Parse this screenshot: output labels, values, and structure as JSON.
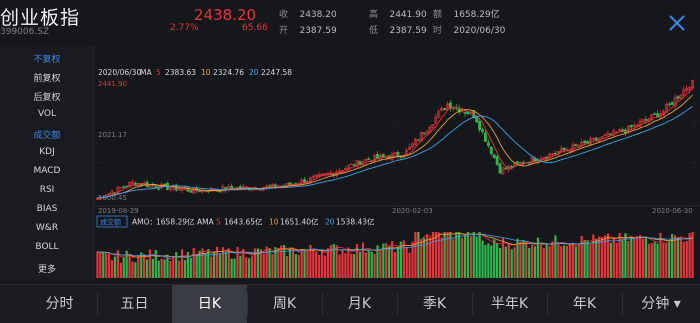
{
  "header": {
    "name": "创业板指",
    "code": "399006.SZ",
    "price": "2438.20",
    "pct_change": "2.77%",
    "change": "65.66",
    "quote": [
      {
        "label": "收",
        "value": "2438.20"
      },
      {
        "label": "高",
        "value": "2441.90"
      },
      {
        "label": "额",
        "value": "1658.29亿"
      },
      {
        "label": "开",
        "value": "2387.59"
      },
      {
        "label": "低",
        "value": "2387.59"
      },
      {
        "label": "时",
        "value": "2020/06/30"
      }
    ],
    "close_icon": "close-icon"
  },
  "sidebar": [
    {
      "label": "不复权",
      "active": true
    },
    {
      "label": "前复权",
      "active": false
    },
    {
      "label": "后复权",
      "active": false
    },
    {
      "label": "VOL",
      "active": false
    },
    {
      "label": "成交额",
      "active": true
    },
    {
      "label": "KDJ",
      "active": false
    },
    {
      "label": "MACD",
      "active": false
    },
    {
      "label": "RSI",
      "active": false
    },
    {
      "label": "BIAS",
      "active": false
    },
    {
      "label": "W&R",
      "active": false
    },
    {
      "label": "BOLL",
      "active": false
    },
    {
      "label": "更多",
      "active": false
    }
  ],
  "chart": {
    "date_label": "2020/06/30",
    "ma_label": "MA",
    "ma": [
      {
        "name": "5",
        "value": "2383.63",
        "color": "#e8343b"
      },
      {
        "name": "10",
        "value": "2324.76",
        "color": "#e8a23a"
      },
      {
        "name": "20",
        "value": "2247.58",
        "color": "#3ea0e8"
      }
    ],
    "y_labels": {
      "high": "2441.90",
      "mid": "2021.17",
      "low": "1600.45"
    },
    "x_labels": [
      "2019-08-29",
      "2020-02-03",
      "2020-06-30"
    ],
    "volume_tag": "成交额",
    "amo_label": "AMO：",
    "amo_value": "1658.29亿",
    "ama_label": "AMA",
    "ama": [
      {
        "name": "5",
        "value": "1643.65亿",
        "color": "#e8343b"
      },
      {
        "name": "10",
        "value": "1651.40亿",
        "color": "#e8a23a"
      },
      {
        "name": "20",
        "value": "1538.43亿",
        "color": "#3ea0e8"
      }
    ],
    "up_color": "#e8343b",
    "down_color": "#2eb84c"
  },
  "chart_data": {
    "type": "candlestick",
    "title": "",
    "price_range": [
      1600.45,
      2441.9
    ],
    "x_range": [
      "2019-08-29",
      "2020-06-30"
    ],
    "anchor_closes": [
      {
        "date": "2019-08-29",
        "close": 1640
      },
      {
        "date": "2019-09-16",
        "close": 1745
      },
      {
        "date": "2019-10-17",
        "close": 1690
      },
      {
        "date": "2019-11-11",
        "close": 1710
      },
      {
        "date": "2019-12-02",
        "close": 1720
      },
      {
        "date": "2019-12-23",
        "close": 1790
      },
      {
        "date": "2020-01-14",
        "close": 1900
      },
      {
        "date": "2020-02-03",
        "close": 1940
      },
      {
        "date": "2020-02-25",
        "close": 2280
      },
      {
        "date": "2020-03-10",
        "close": 2200
      },
      {
        "date": "2020-03-23",
        "close": 1830
      },
      {
        "date": "2020-04-13",
        "close": 1920
      },
      {
        "date": "2020-05-06",
        "close": 2010
      },
      {
        "date": "2020-05-28",
        "close": 2110
      },
      {
        "date": "2020-06-15",
        "close": 2230
      },
      {
        "date": "2020-06-30",
        "close": 2438.2
      }
    ]
  },
  "tabs": [
    {
      "label": "分时",
      "active": false
    },
    {
      "label": "五日",
      "active": false
    },
    {
      "label": "日K",
      "active": true
    },
    {
      "label": "周K",
      "active": false
    },
    {
      "label": "月K",
      "active": false
    },
    {
      "label": "季K",
      "active": false
    },
    {
      "label": "半年K",
      "active": false
    },
    {
      "label": "年K",
      "active": false
    },
    {
      "label": "分钟 ▾",
      "active": false
    }
  ]
}
